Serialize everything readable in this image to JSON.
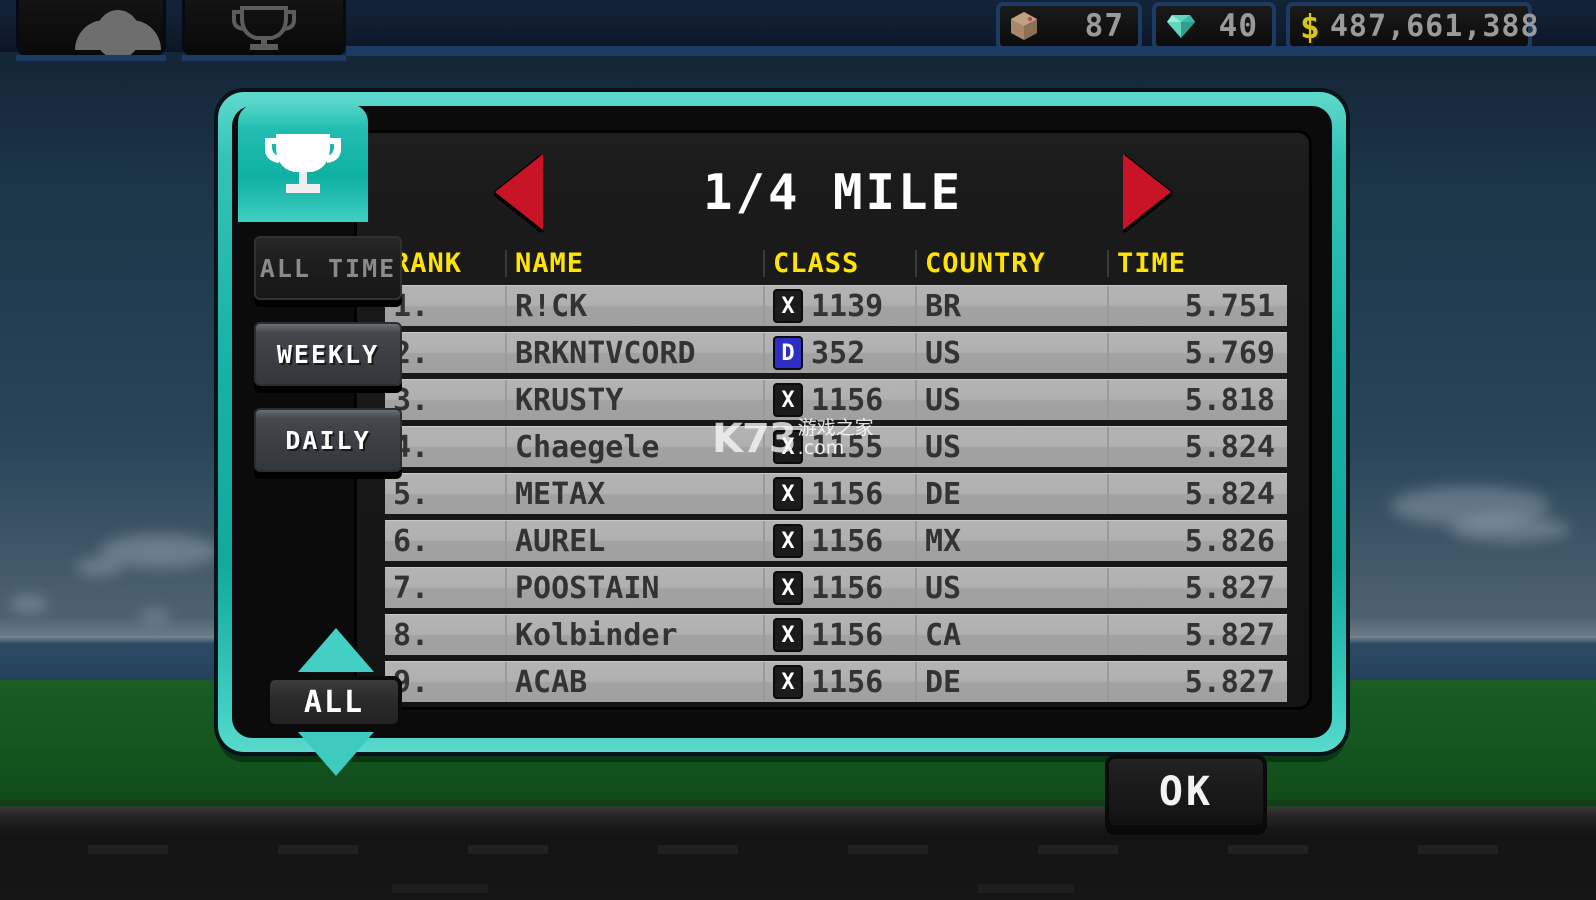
{
  "hud": {
    "tabs": [
      {
        "name": "profile-tab",
        "icon": "person-icon"
      },
      {
        "name": "trophy-tab",
        "icon": "trophy-icon"
      }
    ],
    "counters": [
      {
        "icon": "crate-icon",
        "value": "87"
      },
      {
        "icon": "gem-icon",
        "value": "40"
      },
      {
        "icon": "dollar-icon",
        "value": "487,661,388"
      }
    ]
  },
  "modal": {
    "header_icon": "trophy-icon",
    "title": "1/4 MILE",
    "prev_label": "prev-track",
    "next_label": "next-track",
    "sidebar": {
      "filters": [
        {
          "label": "ALL TIME",
          "selected": true
        },
        {
          "label": "WEEKLY",
          "selected": false
        },
        {
          "label": "DAILY",
          "selected": false
        }
      ],
      "pager": {
        "up_icon": "chevron-up-icon",
        "value": "ALL",
        "down_icon": "chevron-down-icon"
      }
    },
    "table": {
      "columns": [
        "RANK",
        "NAME",
        "CLASS",
        "COUNTRY",
        "TIME"
      ],
      "rows": [
        {
          "rank": "1.",
          "name": "R!CK",
          "class_badge": "X",
          "class_type": "x",
          "class_num": "1139",
          "country": "BR",
          "time": "5.751"
        },
        {
          "rank": "2.",
          "name": "BRKNTVCORD",
          "class_badge": "D",
          "class_type": "d",
          "class_num": "352",
          "country": "US",
          "time": "5.769"
        },
        {
          "rank": "3.",
          "name": "KRUSTY",
          "class_badge": "X",
          "class_type": "x",
          "class_num": "1156",
          "country": "US",
          "time": "5.818"
        },
        {
          "rank": "4.",
          "name": "Chaegele",
          "class_badge": "X",
          "class_type": "x",
          "class_num": "1155",
          "country": "US",
          "time": "5.824"
        },
        {
          "rank": "5.",
          "name": "METAX",
          "class_badge": "X",
          "class_type": "x",
          "class_num": "1156",
          "country": "DE",
          "time": "5.824"
        },
        {
          "rank": "6.",
          "name": "AUREL",
          "class_badge": "X",
          "class_type": "x",
          "class_num": "1156",
          "country": "MX",
          "time": "5.826"
        },
        {
          "rank": "7.",
          "name": "POOSTAIN",
          "class_badge": "X",
          "class_type": "x",
          "class_num": "1156",
          "country": "US",
          "time": "5.827"
        },
        {
          "rank": "8.",
          "name": "Kolbinder",
          "class_badge": "X",
          "class_type": "x",
          "class_num": "1156",
          "country": "CA",
          "time": "5.827"
        },
        {
          "rank": "9.",
          "name": "ACAB",
          "class_badge": "X",
          "class_type": "x",
          "class_num": "1156",
          "country": "DE",
          "time": "5.827"
        }
      ]
    }
  },
  "ok_button": {
    "label": "OK"
  },
  "watermark": {
    "brand": "K73",
    "cn": "游戏之家",
    "domain": ".com"
  },
  "colors": {
    "accent_teal": "#17b3a6",
    "header_yellow": "#ffe400",
    "nav_red": "#c91327",
    "row_gray": "#b0b0b0",
    "badge_blue": "#2e2ec4"
  }
}
